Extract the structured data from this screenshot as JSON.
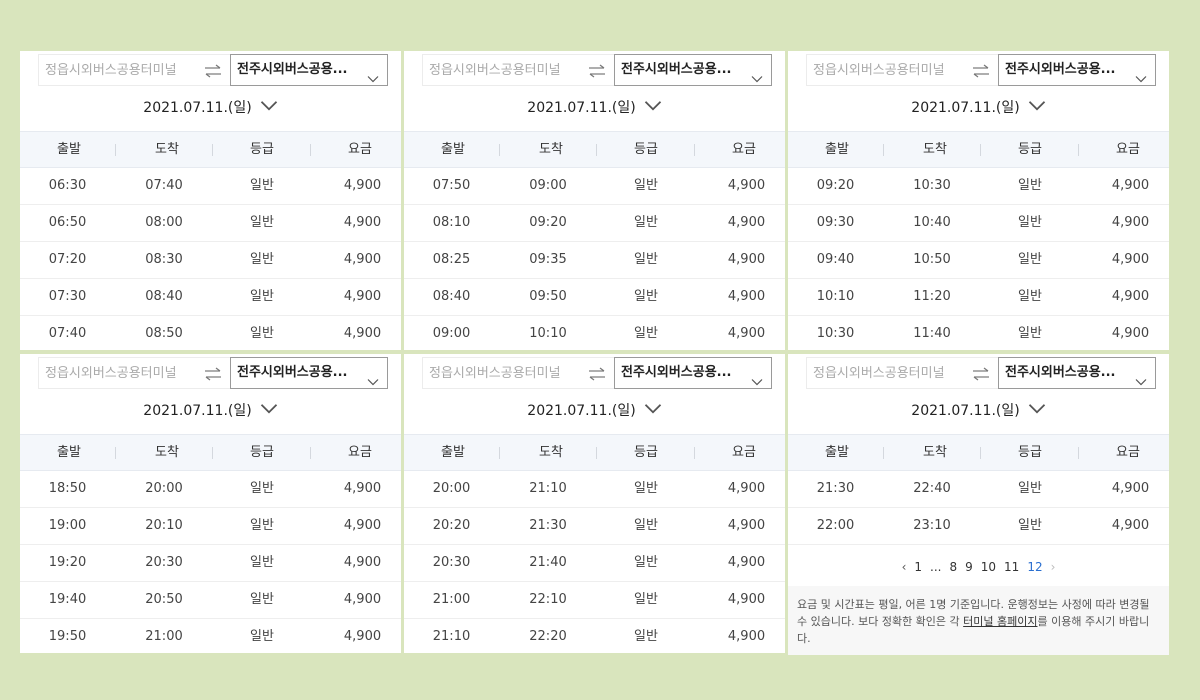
{
  "panels": [
    {
      "from_placeholder": "정읍시외버스공용터미널",
      "to": "전주시외버스공용...",
      "date": "2021.07.11.(일)",
      "headers": [
        "출발",
        "도착",
        "등급",
        "요금"
      ],
      "rows": [
        [
          "06:30",
          "07:40",
          "일반",
          "4,900"
        ],
        [
          "06:50",
          "08:00",
          "일반",
          "4,900"
        ],
        [
          "07:20",
          "08:30",
          "일반",
          "4,900"
        ],
        [
          "07:30",
          "08:40",
          "일반",
          "4,900"
        ],
        [
          "07:40",
          "08:50",
          "일반",
          "4,900"
        ]
      ]
    },
    {
      "from_placeholder": "정읍시외버스공용터미널",
      "to": "전주시외버스공용...",
      "date": "2021.07.11.(일)",
      "headers": [
        "출발",
        "도착",
        "등급",
        "요금"
      ],
      "rows": [
        [
          "07:50",
          "09:00",
          "일반",
          "4,900"
        ],
        [
          "08:10",
          "09:20",
          "일반",
          "4,900"
        ],
        [
          "08:25",
          "09:35",
          "일반",
          "4,900"
        ],
        [
          "08:40",
          "09:50",
          "일반",
          "4,900"
        ],
        [
          "09:00",
          "10:10",
          "일반",
          "4,900"
        ]
      ]
    },
    {
      "from_placeholder": "정읍시외버스공용터미널",
      "to": "전주시외버스공용...",
      "date": "2021.07.11.(일)",
      "headers": [
        "출발",
        "도착",
        "등급",
        "요금"
      ],
      "rows": [
        [
          "09:20",
          "10:30",
          "일반",
          "4,900"
        ],
        [
          "09:30",
          "10:40",
          "일반",
          "4,900"
        ],
        [
          "09:40",
          "10:50",
          "일반",
          "4,900"
        ],
        [
          "10:10",
          "11:20",
          "일반",
          "4,900"
        ],
        [
          "10:30",
          "11:40",
          "일반",
          "4,900"
        ]
      ]
    },
    {
      "from_placeholder": "정읍시외버스공용터미널",
      "to": "전주시외버스공용...",
      "date": "2021.07.11.(일)",
      "headers": [
        "출발",
        "도착",
        "등급",
        "요금"
      ],
      "rows": [
        [
          "18:50",
          "20:00",
          "일반",
          "4,900"
        ],
        [
          "19:00",
          "20:10",
          "일반",
          "4,900"
        ],
        [
          "19:20",
          "20:30",
          "일반",
          "4,900"
        ],
        [
          "19:40",
          "20:50",
          "일반",
          "4,900"
        ],
        [
          "19:50",
          "21:00",
          "일반",
          "4,900"
        ]
      ]
    },
    {
      "from_placeholder": "정읍시외버스공용터미널",
      "to": "전주시외버스공용...",
      "date": "2021.07.11.(일)",
      "headers": [
        "출발",
        "도착",
        "등급",
        "요금"
      ],
      "rows": [
        [
          "20:00",
          "21:10",
          "일반",
          "4,900"
        ],
        [
          "20:20",
          "21:30",
          "일반",
          "4,900"
        ],
        [
          "20:30",
          "21:40",
          "일반",
          "4,900"
        ],
        [
          "21:00",
          "22:10",
          "일반",
          "4,900"
        ],
        [
          "21:10",
          "22:20",
          "일반",
          "4,900"
        ]
      ]
    },
    {
      "from_placeholder": "정읍시외버스공용터미널",
      "to": "전주시외버스공용...",
      "date": "2021.07.11.(일)",
      "headers": [
        "출발",
        "도착",
        "등급",
        "요금"
      ],
      "rows": [
        [
          "21:30",
          "22:40",
          "일반",
          "4,900"
        ],
        [
          "22:00",
          "23:10",
          "일반",
          "4,900"
        ]
      ],
      "pagination": {
        "prev": "‹",
        "pages": [
          "1",
          "...",
          "8",
          "9",
          "10",
          "11",
          "12"
        ],
        "active_page": "12",
        "next": "›"
      },
      "notice": {
        "text_before": "요금 및 시간표는 평일, 어른 1명 기준입니다. 운행정보는 사정에 따라 변경될 수 있습니다. 보다 정확한 확인은 각 ",
        "link": "터미널 홈페이지",
        "text_after": "를 이용해 주시기 바랍니다."
      }
    }
  ],
  "colors": {
    "page_background": "#d9e5bd",
    "header_row": "#f4f7fb",
    "active_page": "#2a6fd0"
  },
  "icons": {
    "swap": "swap-arrows-icon",
    "dropdown": "chevron-down-icon",
    "date": "chevron-down-icon"
  }
}
